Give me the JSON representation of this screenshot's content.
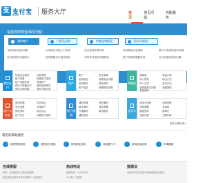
{
  "header": {
    "logo_mark": "支",
    "logo_name": "支付宝",
    "logo_sub": "ALIPAY",
    "title": "服务大厅",
    "nav": [
      "首页",
      "常见问题",
      "自助服务"
    ]
  },
  "banner": {
    "prompt": "请选择您想咨询的问题：",
    "quick_buttons": [
      "我的帐户",
      "付款及退款",
      "余额宝和提现",
      "投诉与维权"
    ],
    "hot_questions": [
      "\"我有密码找回问题\"",
      "父母和支付宝入门手册",
      "支付宝服务费平常",
      "有效期及实名退款",
      "银行卡收发等咨询问题",
      "支付相关的充值提示",
      "您所需要支付相关服务",
      "手机号码相关问题服务",
      "账户网络等重置查询",
      "支付充值相关的问题"
    ]
  },
  "categories": [
    {
      "label": "我的支付",
      "color": "#1e8fd6",
      "links": [
        "快速支付服务",
        "付款流程",
        "帐户设置",
        "快捷支付提现",
        "帐户余额查询",
        "登录帐户",
        "银行卡快捷支付",
        "我的帐单服务",
        "修改注册邮箱",
        "我的付款记录"
      ]
    },
    {
      "label": "账户",
      "color": "#2fa8e0",
      "links": [
        "账户",
        "安全保障",
        "密码找回",
        "设置安全问题",
        "如何解冻",
        "修改资料",
        "账户信息",
        "快捷登录设置"
      ]
    },
    {
      "label": "余额宝",
      "color": "#3fb7a0",
      "links": [
        "余额宝",
        "收益计算",
        "转入规则",
        "转出方式",
        "转入方式",
        "支付方法",
        "余额宝常见问题",
        "余额提现",
        "收益查询"
      ]
    },
    {
      "label": "账户与安全",
      "color": "#e0542e",
      "links": [
        "登录问题",
        "手机验证",
        "安全设置",
        "冻结帐户",
        "修改资料",
        "实名认证",
        "帐户安全",
        "设置支付密码"
      ]
    },
    {
      "label": "账户通知",
      "color": "#2f8ecf",
      "links": [
        "通知设置",
        "短信通知",
        "邮件通知",
        "消息提醒",
        "开通服务",
        "取消服务",
        "通知查询"
      ]
    },
    {
      "label": "信用卡",
      "color": "#3aa6de",
      "links": [
        "信用卡还款",
        "还款到账",
        "还款提醒",
        "手续费",
        "额度查询",
        "账单日",
        "还款记录",
        "分期付款"
      ]
    }
  ],
  "more_link": "更多问题分类 >",
  "guides": {
    "title": "常见的帮助服务",
    "items": [
      "修改登录密码",
      "修改支付密码",
      "修改绑定手机",
      "添加银行卡",
      "查询交易记录",
      "申请退款"
    ]
  },
  "contacts": [
    {
      "title": "在线客服",
      "lines": [
        "您好，欢迎使用支付宝在线客服",
        "如在使用过程中有任何问题可以咨询我们"
      ]
    },
    {
      "title": "热线电话",
      "lines": [
        "服务热线：95188 转 8",
        "24小时人工服务"
      ]
    },
    {
      "title": "提建议",
      "lines": [
        "欢迎您对支付宝的产品和服务提出建议"
      ]
    }
  ]
}
